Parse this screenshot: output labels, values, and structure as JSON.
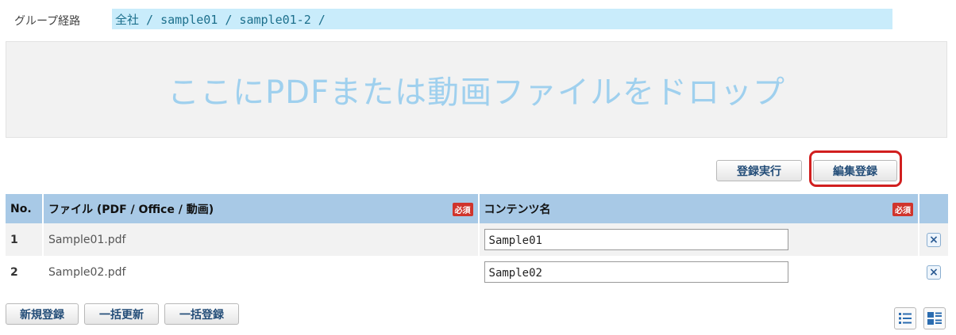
{
  "breadcrumb": {
    "label": "グループ経路",
    "path": "全社 / sample01 / sample01-2 /"
  },
  "dropzone": {
    "text": "ここにPDFまたは動画ファイルをドロップ"
  },
  "actions": {
    "register_execute": "登録実行",
    "edit_register": "編集登録"
  },
  "table": {
    "headers": {
      "no": "No.",
      "file": "ファイル (PDF / Office / 動画)",
      "content_name": "コンテンツ名",
      "required_badge": "必須"
    },
    "rows": [
      {
        "no": "1",
        "file": "Sample01.pdf",
        "content_name": "Sample01",
        "delete": "×"
      },
      {
        "no": "2",
        "file": "Sample02.pdf",
        "content_name": "Sample02",
        "delete": "×"
      }
    ]
  },
  "bottom_actions": {
    "new_register": "新規登録",
    "bulk_update": "一括更新",
    "bulk_register": "一括登録"
  },
  "icons": {
    "list_view": "list-view-icon",
    "detail_view": "detail-view-icon"
  },
  "colors": {
    "accent": "#a8c9e6",
    "breadcrumb_bg": "#c9ecfb",
    "highlight": "#d11f1f",
    "required": "#d0342c",
    "dropzone_text": "#9fd0ee"
  }
}
